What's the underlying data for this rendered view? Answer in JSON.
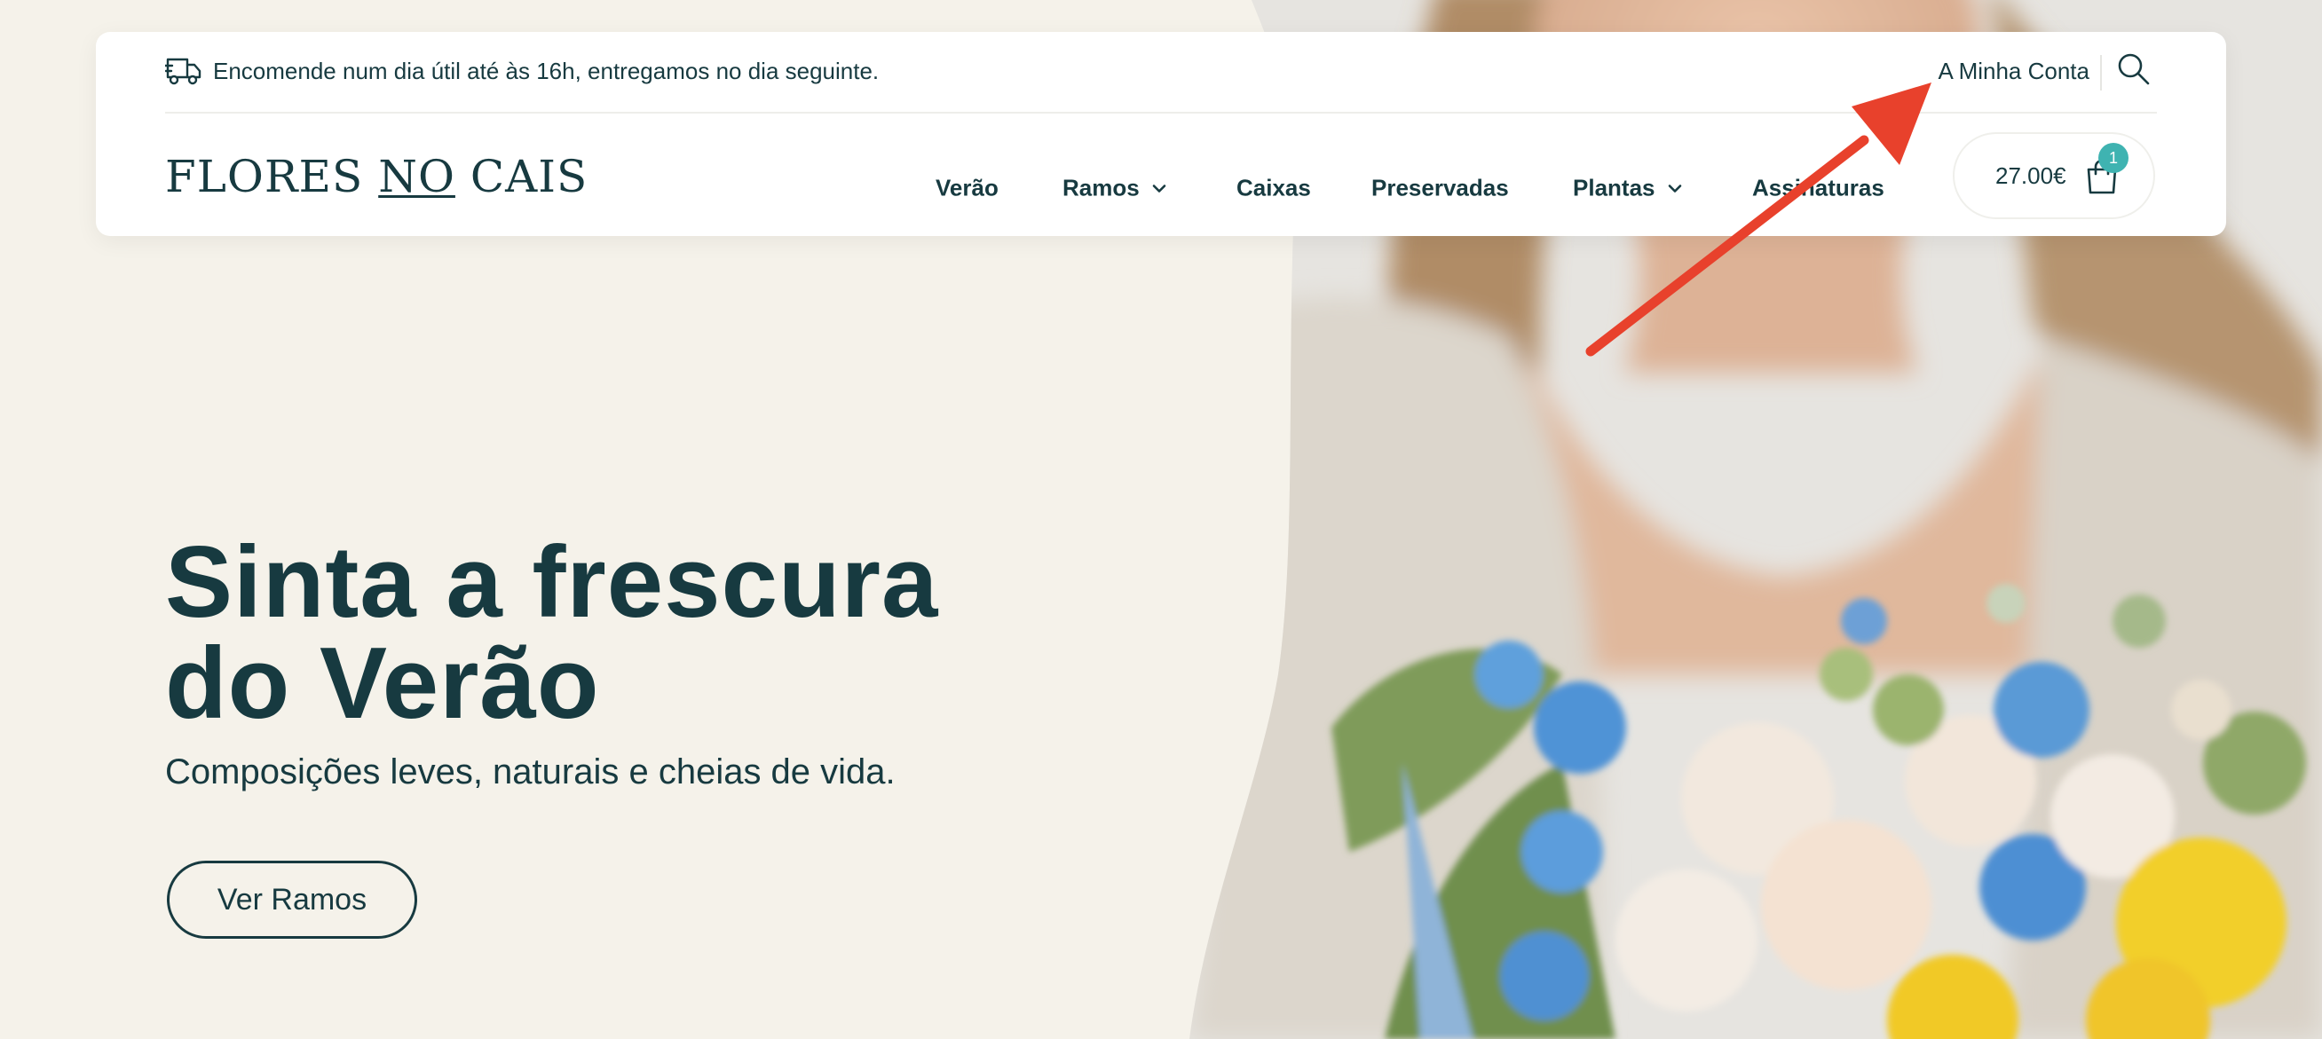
{
  "header": {
    "delivery_notice": "Encomende num dia útil até às 16h, entregamos no dia seguinte.",
    "account_link": "A Minha Conta",
    "logo": {
      "part1": "FLORES ",
      "part2": "NO",
      "part3": " CAIS"
    },
    "nav": [
      {
        "label": "Verão",
        "has_dropdown": false
      },
      {
        "label": "Ramos",
        "has_dropdown": true
      },
      {
        "label": "Caixas",
        "has_dropdown": false
      },
      {
        "label": "Preservadas",
        "has_dropdown": false
      },
      {
        "label": "Plantas",
        "has_dropdown": true
      },
      {
        "label": "Assinaturas",
        "has_dropdown": false
      }
    ],
    "cart": {
      "total": "27.00€",
      "count": "1"
    }
  },
  "hero": {
    "title_line1": "Sinta a frescura",
    "title_line2": "do Verão",
    "subtitle": "Composições leves, naturais e cheias de vida.",
    "cta": "Ver Ramos"
  },
  "colors": {
    "background": "#f5f2ea",
    "text": "#173a40",
    "badge": "#3fb3b1",
    "annotation": "#e8412c"
  },
  "icons": [
    "truck-icon",
    "search-icon",
    "chevron-down-icon",
    "shopping-bag-icon"
  ]
}
